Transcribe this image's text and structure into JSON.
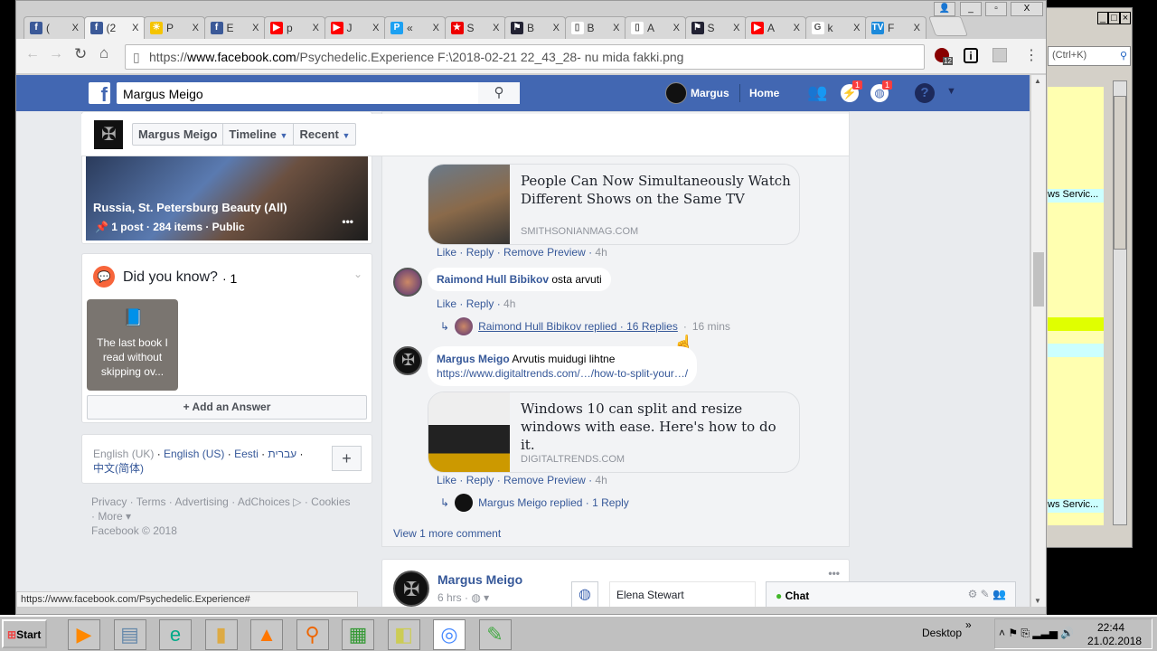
{
  "browser": {
    "tabs": [
      {
        "label": "(",
        "color": "#3b5998",
        "glyph": "f"
      },
      {
        "label": "(2",
        "color": "#3b5998",
        "glyph": "f",
        "active": true
      },
      {
        "label": "P",
        "color": "#f5c400",
        "glyph": "☀"
      },
      {
        "label": "E",
        "color": "#3b5998",
        "glyph": "f"
      },
      {
        "label": "p",
        "color": "#ff0000",
        "glyph": "▶"
      },
      {
        "label": "J",
        "color": "#ff0000",
        "glyph": "▶"
      },
      {
        "label": "«",
        "color": "#1da1f2",
        "glyph": "P"
      },
      {
        "label": "S",
        "color": "#e00",
        "glyph": "★"
      },
      {
        "label": "B",
        "color": "#223",
        "glyph": "⚑"
      },
      {
        "label": "B",
        "color": "#fff",
        "glyph": "▯"
      },
      {
        "label": "A",
        "color": "#fff",
        "glyph": "▯"
      },
      {
        "label": "S",
        "color": "#223",
        "glyph": "⚑"
      },
      {
        "label": "A",
        "color": "#ff0000",
        "glyph": "▶"
      },
      {
        "label": "k",
        "color": "#fff",
        "glyph": "G"
      },
      {
        "label": "F",
        "color": "#1c8adb",
        "glyph": "TV"
      }
    ],
    "url_prefix": "https://",
    "url_domain": "www.facebook.com",
    "url_rest": "/Psychedelic.Experience F:\\2018-02-21 22_43_28- nu mida fakki.png",
    "extension_badge": "12",
    "status_url": "https://www.facebook.com/Psychedelic.Experience#"
  },
  "fb": {
    "search_value": "Margus Meigo",
    "user": "Margus",
    "home": "Home",
    "messages_badge": "1",
    "notifications_badge": "1",
    "profile_nav": {
      "name": "Margus Meigo",
      "timeline": "Timeline",
      "recent": "Recent"
    },
    "album": {
      "title": "Russia, St. Petersburg Beauty (All)",
      "meta": "1 post · 284 items · Public"
    },
    "did_you_know": {
      "title": "Did you know?",
      "count": "· 1",
      "card_text": "The last book I read without skipping ov...",
      "add_answer": "Add an Answer"
    },
    "languages": {
      "current": "English (UK)",
      "others": [
        "English (US)",
        "Eesti",
        "עברית"
      ],
      "chinese": "中文(简体)"
    },
    "footer": {
      "links": [
        "Privacy",
        "Terms",
        "Advertising",
        "AdChoices",
        "Cookies",
        "More"
      ],
      "copyright": "Facebook © 2018"
    },
    "comments": [
      {
        "preview_title": "People Can Now Simultaneously Watch Different Shows on the Same TV",
        "preview_domain": "SMITHSONIANMAG.COM",
        "actions": [
          "Like",
          "Reply",
          "Remove Preview"
        ],
        "time": "4h"
      },
      {
        "author": "Raimond Hull Bibikov",
        "text": "osta arvuti",
        "actions": [
          "Like",
          "Reply"
        ],
        "time": "4h",
        "replies_link": "Raimond Hull Bibikov replied · 16 Replies",
        "replies_time": "16 mins"
      },
      {
        "author": "Margus Meigo",
        "text": "Arvutis muidugi lihtne",
        "link": "https://www.digitaltrends.com/…/how-to-split-your…/",
        "preview_title": "Windows 10 can split and resize windows with ease. Here's how to do it.",
        "preview_domain": "DIGITALTRENDS.COM",
        "actions": [
          "Like",
          "Reply",
          "Remove Preview"
        ],
        "time": "4h",
        "replies_link": "Margus Meigo replied · 1 Reply"
      }
    ],
    "view_more": "View 1 more comment",
    "next_post": {
      "author": "Margus Meigo",
      "time": "6 hrs"
    },
    "chat": {
      "contact": "Elena Stewart",
      "label": "Chat"
    }
  },
  "side_window": {
    "search_hint": "(Ctrl+K)",
    "row_text": "ws Servic..."
  },
  "taskbar": {
    "start": "Start",
    "desktop": "Desktop",
    "time": "22:44",
    "date": "21.02.2018"
  }
}
